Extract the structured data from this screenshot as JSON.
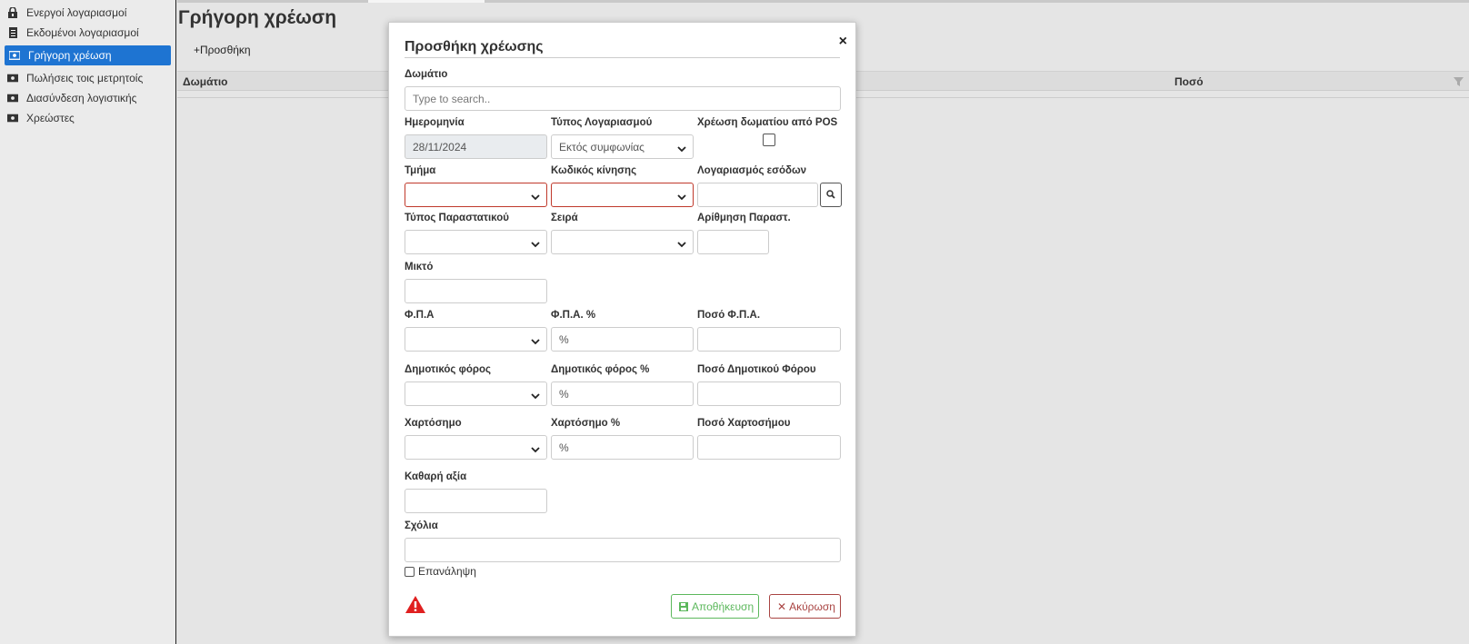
{
  "sidebar": {
    "items": [
      {
        "label": "Ενεργοί λογαριασμοί",
        "icon": "lock-icon",
        "active": false
      },
      {
        "label": "Εκδομένοι λογαριασμοί",
        "icon": "document-icon",
        "active": false
      },
      {
        "label": "Γρήγορη χρέωση",
        "icon": "money-icon",
        "active": true
      },
      {
        "label": "Πωλήσεις τοις μετρητοίς",
        "icon": "money-icon",
        "active": false
      },
      {
        "label": "Διασύνδεση λογιστικής",
        "icon": "money-icon",
        "active": false
      },
      {
        "label": "Χρεώστες",
        "icon": "money-icon",
        "active": false
      }
    ]
  },
  "page": {
    "title": "Γρήγορη χρέωση",
    "add_label": "Προσθήκη",
    "columns": [
      "Δωμάτιο",
      "Ποσό"
    ]
  },
  "modal": {
    "title": "Προσθήκη χρέωσης",
    "close": "×",
    "room_label": "Δωμάτιο",
    "room_placeholder": "Type to search..",
    "date_label": "Ημερομηνία",
    "date_value": "28/11/2024",
    "account_type_label": "Τύπος Λογαριασμού",
    "account_type_value": "Εκτός συμφωνίας",
    "pos_charge_label": "Χρέωση δωματίου από POS",
    "department_label": "Τμήμα",
    "movement_code_label": "Κωδικός κίνησης",
    "revenue_account_label": "Λογαριασμός εσόδων",
    "doc_type_label": "Τύπος Παραστατικού",
    "series_label": "Σειρά",
    "doc_number_label": "Αρίθμηση Παραστ.",
    "gross_label": "Μικτό",
    "vat_label": "Φ.Π.Α",
    "vat_pct_label": "Φ.Π.Α. %",
    "vat_amount_label": "Ποσό Φ.Π.Α.",
    "municipal_tax_label": "Δημοτικός φόρος",
    "municipal_tax_pct_label": "Δημοτικός φόρος %",
    "municipal_tax_amount_label": "Ποσό Δημοτικού Φόρου",
    "stamp_label": "Χαρτόσημο",
    "stamp_pct_label": "Χαρτόσημο %",
    "stamp_amount_label": "Ποσό Χαρτοσήμου",
    "pct_symbol": "%",
    "net_label": "Καθαρή αξία",
    "comments_label": "Σχόλια",
    "repeat_label": "Επανάληψη",
    "save_label": "Αποθήκευση",
    "cancel_label": "Ακύρωση"
  },
  "colors": {
    "accent": "#1e74d2",
    "error": "#c0392b",
    "success": "#5cb85c",
    "danger": "#a94442"
  }
}
